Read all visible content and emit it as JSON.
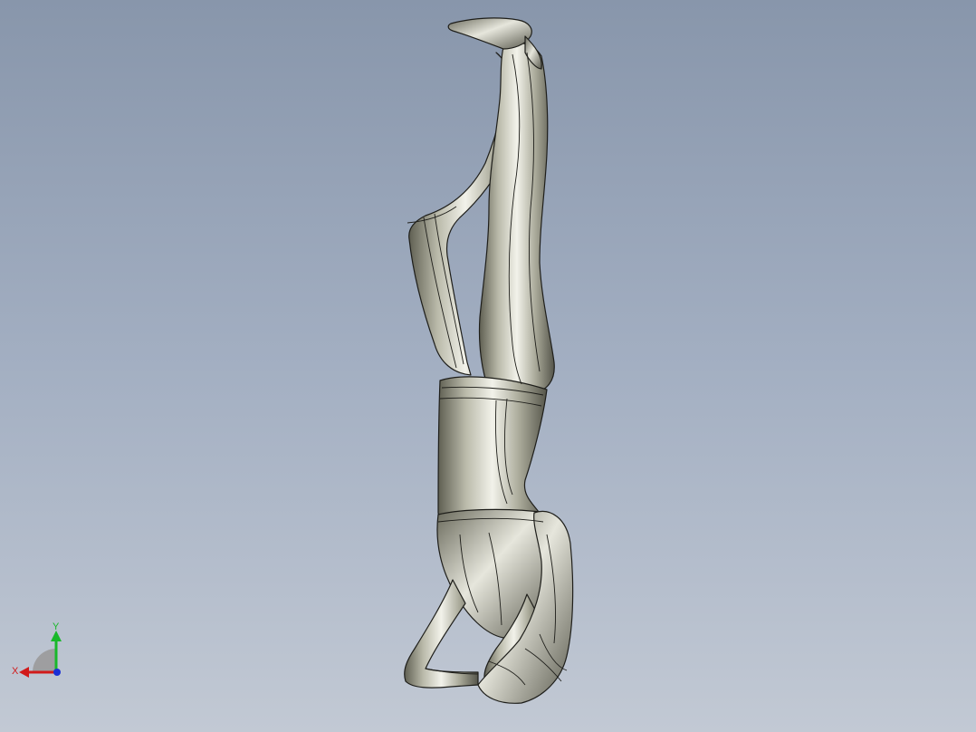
{
  "viewport": {
    "model": "headstand-figure-model"
  },
  "triad": {
    "y_label": "Y",
    "x_label": "X",
    "colors": {
      "x": "#d11a1a",
      "y": "#19b82a",
      "z": "#1a2fd6"
    }
  }
}
